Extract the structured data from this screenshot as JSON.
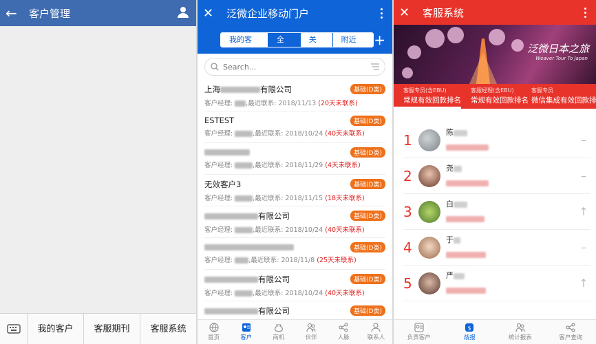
{
  "screen1": {
    "title": "客户管理",
    "menu": [
      "我的客户",
      "客服期刊",
      "客服系统"
    ],
    "icons": {
      "back": "back-arrow-icon",
      "user": "person-icon",
      "keyboard": "keyboard-icon"
    }
  },
  "screen2": {
    "title": "泛微企业移动门户",
    "tabs": [
      "我的客户",
      "全部",
      "关注",
      "附近"
    ],
    "active_tab": "全部",
    "search_placeholder": "Search...",
    "rows": [
      {
        "name": "上海",
        "name_suffix": "有限公司",
        "manager_label": "客户经理: ",
        "contact": ",最近联系: 2018/11/13 ",
        "due": "(20天未联系)",
        "badge": "基础(D类)"
      },
      {
        "name": "ESTEST",
        "name_suffix": "",
        "manager_label": "客户经理: ",
        "contact": ",最近联系: 2018/10/24 ",
        "due": "(40天未联系)",
        "badge": "基础(D类)"
      },
      {
        "name": "",
        "name_suffix": "",
        "manager_label": "客户经理: ",
        "contact": ",最近联系: 2018/11/29 ",
        "due": "(4天未联系)",
        "badge": "基础(D类)"
      },
      {
        "name": "无效客户3",
        "name_suffix": "",
        "manager_label": "客户经理: ",
        "contact": ",最近联系: 2018/11/15 ",
        "due": "(18天未联系)",
        "badge": "基础(D类)"
      },
      {
        "name": "",
        "name_suffix": "有限公司",
        "manager_label": "客户经理: ",
        "contact": ",最近联系: 2018/10/24 ",
        "due": "(40天未联系)",
        "badge": "基础(D类)"
      },
      {
        "name": "",
        "name_suffix": "",
        "manager_label": "客户经理: ",
        "contact": ",最近联系: 2018/11/8 ",
        "due": "(25天未联系)",
        "badge": "基础(D类)"
      },
      {
        "name": "",
        "name_suffix": "有限公司",
        "manager_label": "客户经理: ",
        "contact": ",最近联系: 2018/10/24 ",
        "due": "(40天未联系)",
        "badge": "基础(D类)"
      },
      {
        "name": "",
        "name_suffix": "有限公司",
        "manager_label": "",
        "contact": "",
        "due": "",
        "badge": "基础(D类)"
      }
    ],
    "nav": [
      {
        "label": "首页",
        "icon": "globe-icon"
      },
      {
        "label": "客户",
        "icon": "contact-card-icon"
      },
      {
        "label": "商机",
        "icon": "money-bag-icon"
      },
      {
        "label": "伙伴",
        "icon": "partners-icon"
      },
      {
        "label": "人脉",
        "icon": "share-icon"
      },
      {
        "label": "联系人",
        "icon": "person-icon"
      }
    ],
    "active_nav": "客户",
    "colors": {
      "primary": "#0f65d8",
      "badge": "#ef7019",
      "alert": "#e01f1f"
    }
  },
  "screen3": {
    "title": "客服系统",
    "banner_text": "泛微日本之旅",
    "banner_sub": "Weaver Tour To Japan",
    "rank_tabs": [
      {
        "sub": "客服专员(含EBU)",
        "main": "常规有效回款排名"
      },
      {
        "sub": "客服经理(含EBU)",
        "main": "常规有效回款排名"
      },
      {
        "sub": "客服专员",
        "main": "微信集成有效回款排名"
      }
    ],
    "ranks": [
      {
        "num": "1",
        "name": "陈",
        "trend": "–"
      },
      {
        "num": "2",
        "name": "尧",
        "trend": "–"
      },
      {
        "num": "3",
        "name": "白",
        "trend": "↑"
      },
      {
        "num": "4",
        "name": "于",
        "trend": "–"
      },
      {
        "num": "5",
        "name": "严",
        "trend": "↑"
      }
    ],
    "nav": [
      {
        "label": "负责客户",
        "icon": "contact-card-icon"
      },
      {
        "label": "战报",
        "icon": "money-bag-icon"
      },
      {
        "label": "统计报表",
        "icon": "partners-icon"
      },
      {
        "label": "客户查询",
        "icon": "share-icon"
      }
    ],
    "active_nav": "战报",
    "colors": {
      "primary": "#e8332b"
    }
  }
}
